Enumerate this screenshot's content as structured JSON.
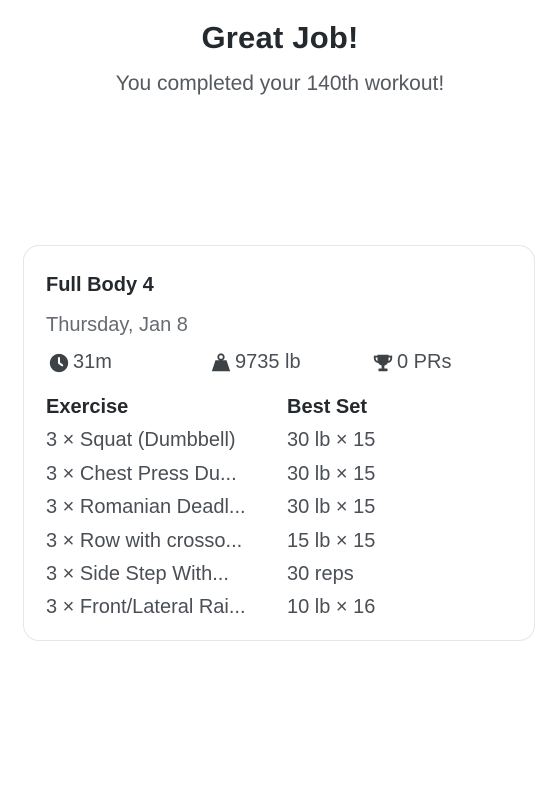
{
  "colors": {
    "accent": "#f5c518",
    "text_primary": "#24292e",
    "text_secondary": "#555a60"
  },
  "header": {
    "title": "Great Job!",
    "subtitle": "You completed your 140th workout!"
  },
  "workout": {
    "name": "Full Body 4",
    "date": "Thursday, Jan 8",
    "stats": {
      "duration": "31m",
      "volume": "9735 lb",
      "prs": "0 PRs"
    },
    "icons": {
      "duration": "clock-icon",
      "volume": "weight-icon",
      "prs": "trophy-icon"
    },
    "table": {
      "headers": [
        "Exercise",
        "Best Set"
      ],
      "rows": [
        [
          "3 × Squat (Dumbbell)",
          "30 lb × 15"
        ],
        [
          "3 × Chest Press Du...",
          "30 lb × 15"
        ],
        [
          "3 × Romanian Deadl...",
          "30 lb × 15"
        ],
        [
          "3 × Row with crosso...",
          "15 lb × 15"
        ],
        [
          "3 × Side Step With...",
          "30 reps"
        ],
        [
          "3 × Front/Lateral Rai...",
          "10 lb × 16"
        ]
      ]
    }
  }
}
